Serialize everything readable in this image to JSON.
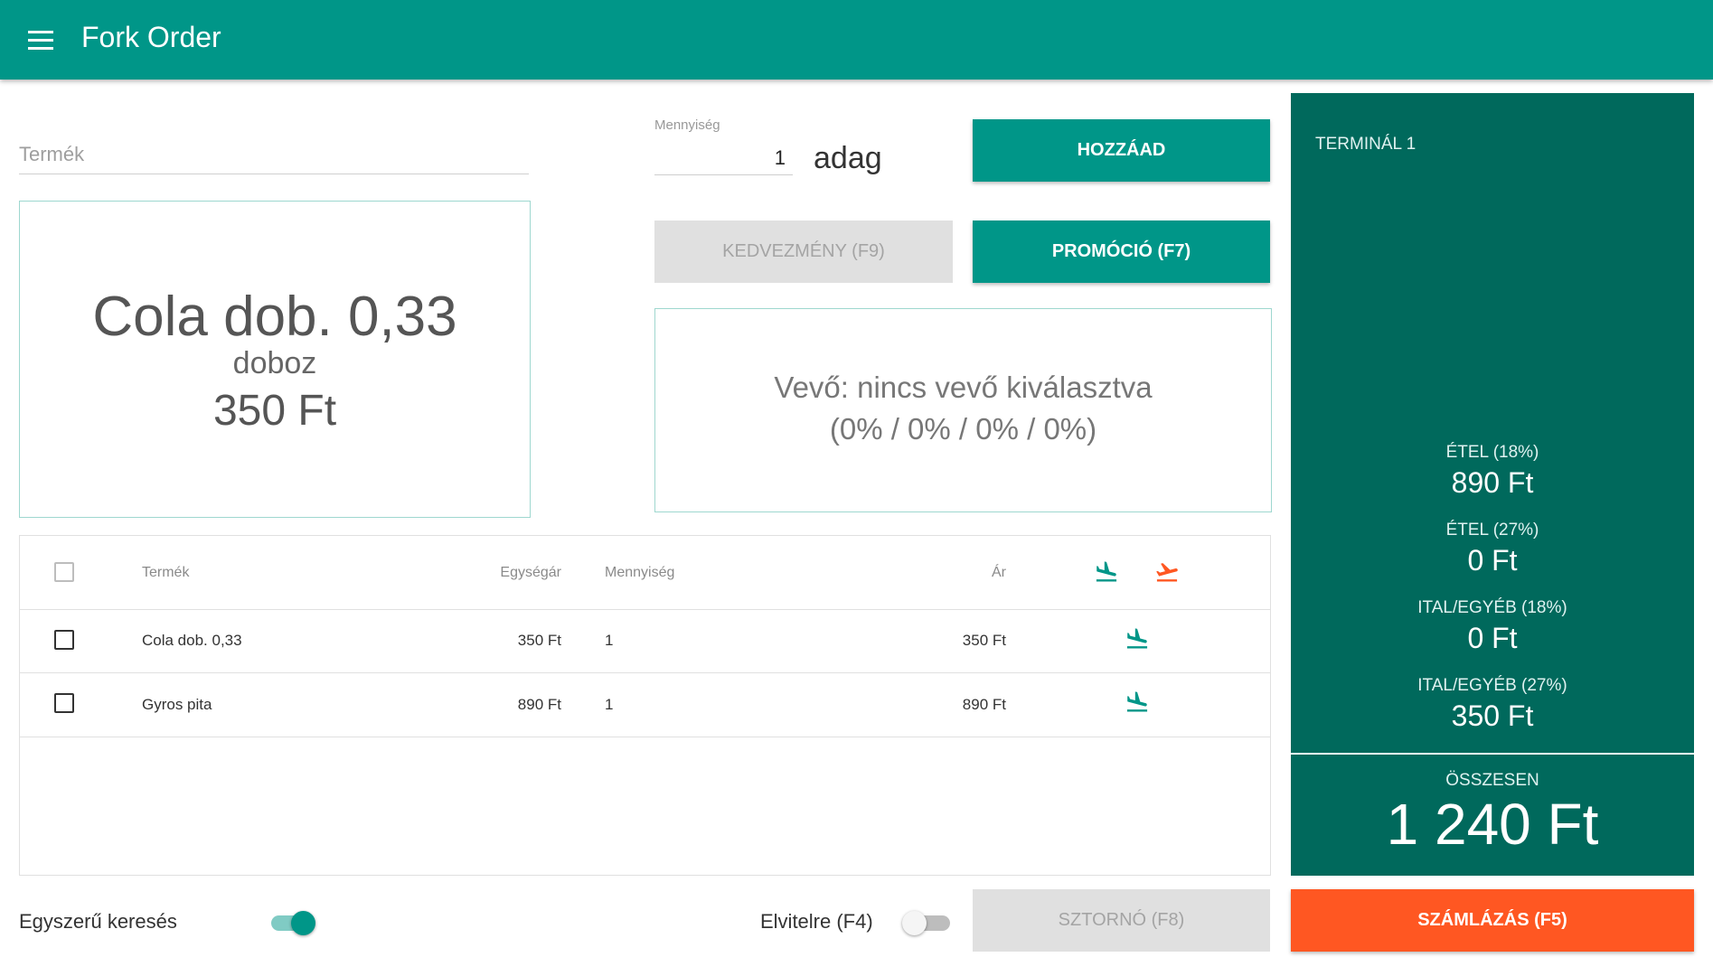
{
  "app": {
    "title": "Fork Order"
  },
  "icons": {
    "menu": "menu-icon",
    "arrival": "flight-land-icon",
    "departure": "flight-takeoff-icon"
  },
  "colors": {
    "primary": "#009688",
    "dark": "#00695c",
    "accent": "#ff5722"
  },
  "product_input": {
    "label": "Termék",
    "value": ""
  },
  "quantity": {
    "label": "Mennyiség",
    "value": "1",
    "unit": "adag"
  },
  "buttons": {
    "add": "HOZZÁAD",
    "discount": "KEDVEZMÉNY (F9)",
    "promotion": "PROMÓCIÓ (F7)",
    "storno": "SZTORNÓ (F8)",
    "invoice": "SZÁMLÁZÁS (F5)"
  },
  "selected_product": {
    "name": "Cola dob. 0,33",
    "unit": "doboz",
    "price": "350 Ft"
  },
  "customer": {
    "line1": "Vevő: nincs vevő kiválasztva",
    "line2": "(0% / 0% / 0% / 0%)"
  },
  "table": {
    "headers": {
      "product": "Termék",
      "unit_price": "Egységár",
      "quantity": "Mennyiség",
      "price": "Ár"
    },
    "rows": [
      {
        "product": "Cola dob. 0,33",
        "unit_price": "350 Ft",
        "quantity": "1",
        "price": "350 Ft"
      },
      {
        "product": "Gyros pita",
        "unit_price": "890 Ft",
        "quantity": "1",
        "price": "890 Ft"
      }
    ]
  },
  "bottom": {
    "simple_search_label": "Egyszerű keresés",
    "simple_search_on": true,
    "takeaway_label": "Elvitelre (F4)",
    "takeaway_on": false
  },
  "terminal": {
    "name": "TERMINÁL 1",
    "tax_lines": [
      {
        "label": "ÉTEL (18%)",
        "amount": "890 Ft"
      },
      {
        "label": "ÉTEL (27%)",
        "amount": "0 Ft"
      },
      {
        "label": "ITAL/EGYÉB (18%)",
        "amount": "0 Ft"
      },
      {
        "label": "ITAL/EGYÉB (27%)",
        "amount": "350 Ft"
      }
    ],
    "total_label": "ÖSSZESEN",
    "total_value": "1 240 Ft"
  }
}
